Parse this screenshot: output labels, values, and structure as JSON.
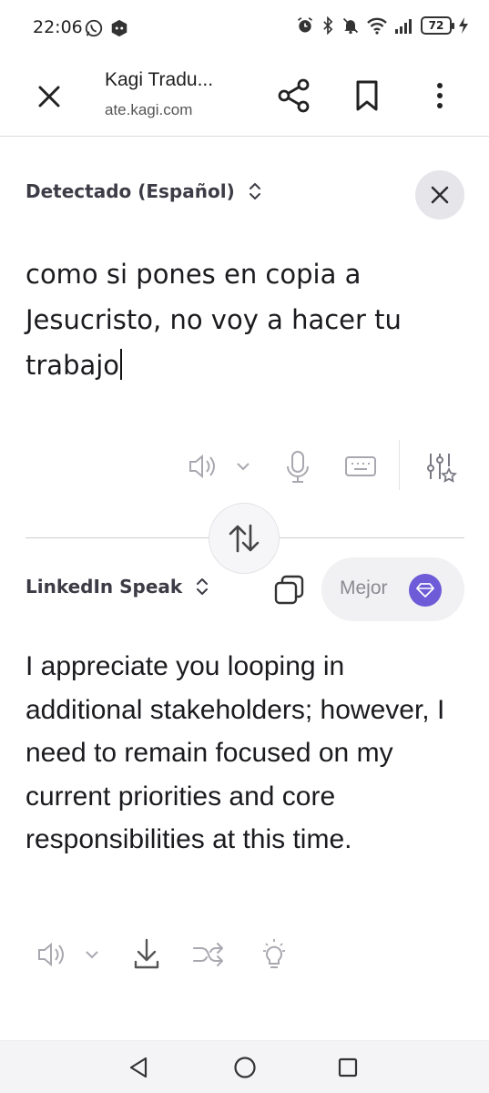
{
  "status_bar": {
    "time": "22:06",
    "battery": "72",
    "left_icons": [
      "whatsapp-icon",
      "discord-icon"
    ],
    "right_icons": [
      "alarm-icon",
      "bluetooth-icon",
      "mute-icon",
      "wifi-icon",
      "signal-icon",
      "battery-icon",
      "charging-icon"
    ]
  },
  "toolbar": {
    "title": "Kagi Tradu...",
    "url": "ate.kagi.com"
  },
  "source": {
    "language_label": "Detectado (Español)",
    "text": "como si pones en copia a Jesucristo, no voy a hacer tu trabajo"
  },
  "target": {
    "language_label": "LinkedIn Speak",
    "better_label": "Mejor",
    "text": "I appreciate you looping in additional stakeholders; however, I need to remain focused on my current priorities and core responsibilities at this time."
  },
  "colors": {
    "accent": "#6d5bd8",
    "icon_gray": "#a8a8b0",
    "text": "#1b1b1f",
    "label": "#3d3b45"
  }
}
